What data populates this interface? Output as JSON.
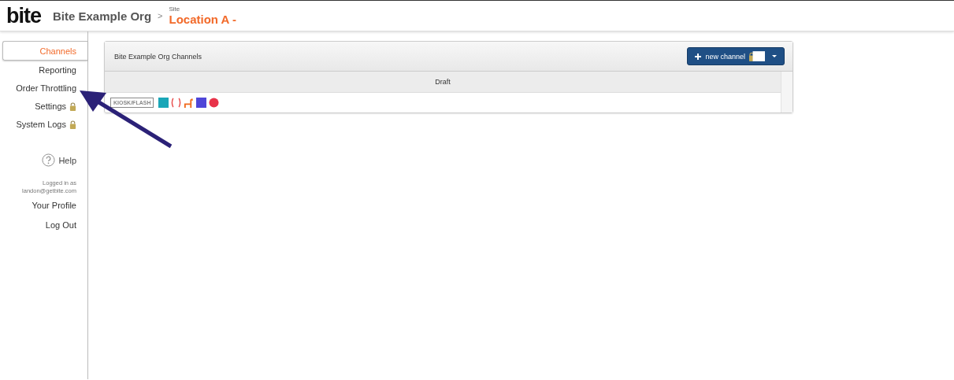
{
  "header": {
    "logo": "bite",
    "org": "Bite Example Org",
    "separator": ">",
    "site_label": "Site",
    "site": "Location A -"
  },
  "sidebar": {
    "items": [
      {
        "label": "Channels",
        "selected": true,
        "locked": false
      },
      {
        "label": "Reporting",
        "selected": false,
        "locked": false
      },
      {
        "label": "Order Throttling",
        "selected": false,
        "locked": false
      },
      {
        "label": "Settings",
        "selected": false,
        "locked": true
      },
      {
        "label": "System Logs",
        "selected": false,
        "locked": true
      }
    ],
    "help": "Help",
    "logged_in_as": "Logged in as",
    "email": "landon@getbite.com",
    "links": [
      "Your Profile",
      "Log Out"
    ]
  },
  "panel": {
    "title": "Bite Example Org Channels",
    "new_button": "new channel",
    "columns": [
      "Draft"
    ],
    "rows": [
      {
        "tag": "KIOSK/FLASH",
        "apps": [
          {
            "color": "#1aa6b7"
          },
          {
            "color": "#e8504f"
          },
          {
            "color": "#f06a1c"
          },
          {
            "color": "#4f46d8"
          },
          {
            "color": "#e8334a"
          }
        ]
      }
    ]
  }
}
